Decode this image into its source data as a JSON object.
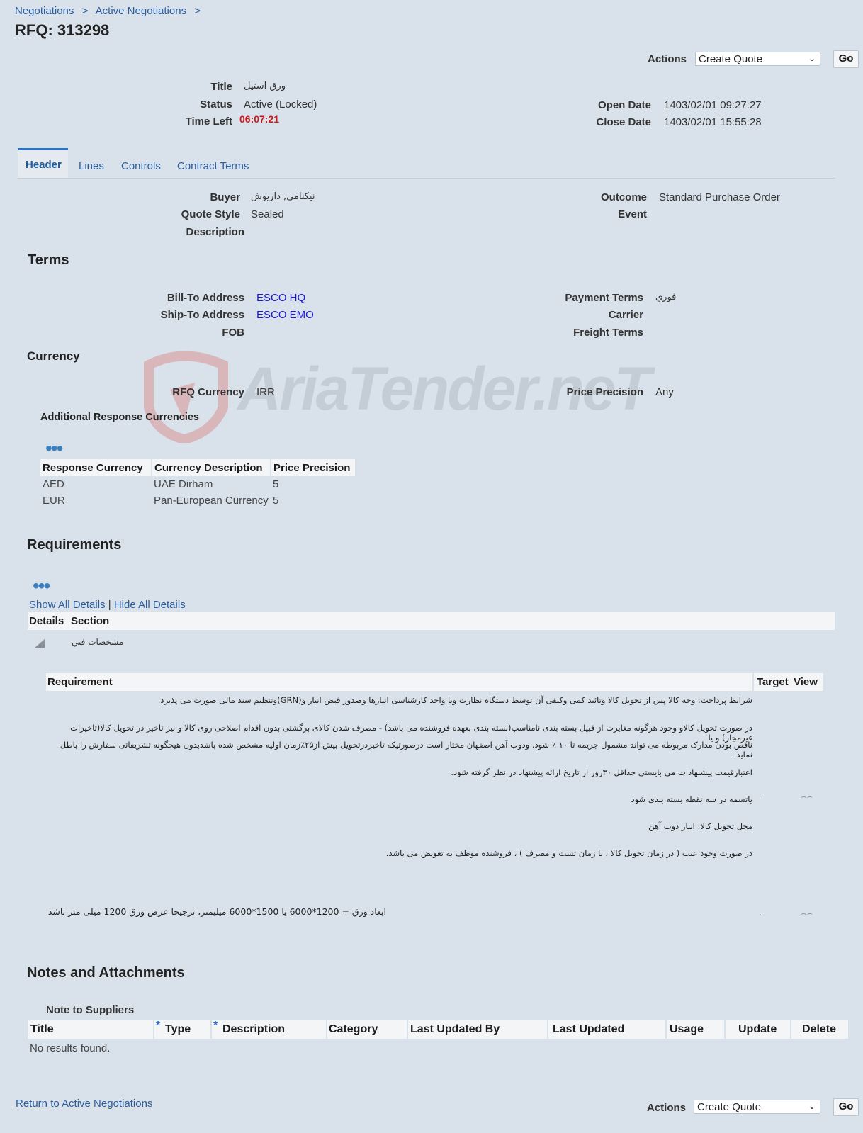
{
  "breadcrumb": [
    "Negotiations",
    ">",
    "Active Negotiations",
    ">"
  ],
  "page_title": "RFQ: 313298",
  "actions": {
    "label": "Actions",
    "selected": "Create Quote",
    "go": "Go"
  },
  "summary": {
    "title_label": "Title",
    "title": "ورق استیل",
    "status_label": "Status",
    "status": "Active (Locked)",
    "time_left_label": "Time Left",
    "time_left": "06:07:21",
    "open_date_label": "Open Date",
    "open_date": "1403/02/01 09:27:27",
    "close_date_label": "Close Date",
    "close_date": "1403/02/01 15:55:28"
  },
  "tabs": [
    "Header",
    "Lines",
    "Controls",
    "Contract Terms"
  ],
  "header": {
    "buyer_label": "Buyer",
    "buyer": "نيكنامي, داريوش",
    "quote_style_label": "Quote Style",
    "quote_style": "Sealed",
    "description_label": "Description",
    "outcome_label": "Outcome",
    "outcome": "Standard Purchase Order",
    "event_label": "Event"
  },
  "terms": {
    "heading": "Terms",
    "bill_to_label": "Bill-To Address",
    "bill_to": "ESCO HQ",
    "ship_to_label": "Ship-To Address",
    "ship_to": "ESCO EMO",
    "fob_label": "FOB",
    "payment_terms_label": "Payment Terms",
    "payment_terms": "فوري",
    "carrier_label": "Carrier",
    "freight_terms_label": "Freight Terms"
  },
  "currency": {
    "heading": "Currency",
    "rfq_currency_label": "RFQ Currency",
    "rfq_currency": "IRR",
    "price_precision_label": "Price Precision",
    "price_precision": "Any",
    "additional_heading": "Additional Response Currencies",
    "columns": [
      "Response Currency",
      "Currency Description",
      "Price Precision"
    ],
    "rows": [
      [
        "AED",
        "UAE Dirham",
        "5"
      ],
      [
        "EUR",
        "Pan-European Currency",
        "5"
      ]
    ]
  },
  "watermark": "AriaTender.neT",
  "requirements": {
    "heading": "Requirements",
    "show_all": "Show All Details",
    "separator": "|",
    "hide_all": "Hide All Details",
    "columns": [
      "Details",
      "Section"
    ],
    "section_name": "مشخصات فني",
    "req_columns": [
      "Requirement",
      "Target",
      "View"
    ],
    "req1_lines": [
      "شرایط پرداخت: وجه کالا پس از تحویل کالا وتائید کمی وکیفی آن توسط دستگاه نظارت ویا واحد کارشناسی انبارها وصدور قبض انبار و(GRN)وتنظیم سند مالی صورت می پذیرد.",
      "در صورت تحویل کالاو وجود هرگونه مغایرت از قبیل بسته بندی نامناسب(بسته بندی بعهده فروشنده می باشد) - مصرف شدن کالای برگشتی بدون اقدام اصلاحی روی کالا و نیز تاخیر در تحویل کالا(تاخیرات غیرمجاز) و یا",
      "ناقص بودن مدارک مربوطه می تواند مشمول جریمه تا ۱۰ ٪ شود. وذوب آهن اصفهان مختار است درصورتیکه تاخیردرتحویل بیش از۲۵٪زمان اولیه مشخص شده باشدبدون هیچگونه تشریفاتی سفارش را باطل نماید.",
      "اعتبارقیمت پیشنهادات می بایستی حداقل ۳۰روز از تاریخ ارائه پیشنهاد در نظر گرفته شود.",
      "یاتسمه در سه نقطه بسته بندی شود",
      "محل تحویل کالا: انبار ذوب آهن",
      "در صورت وجود عیب ( در زمان تحویل کالا ، یا زمان تست و مصرف ) ، فروشنده موظف به تعویض می باشد."
    ],
    "req2": "ابعاد ورق = 1200*6000 یا 1500*6000 میلیمتر، ترجیحا عرض ورق 1200 میلی متر باشد",
    "dot": "."
  },
  "notes": {
    "heading": "Notes and Attachments",
    "sub_heading": "Note to Suppliers",
    "required_mark": "*",
    "columns": [
      "Title",
      "Type",
      "Description",
      "Category",
      "Last Updated By",
      "Last Updated",
      "Usage",
      "Update",
      "Delete"
    ],
    "empty": "No results found."
  },
  "footer": {
    "return_link": "Return to Active Negotiations"
  }
}
